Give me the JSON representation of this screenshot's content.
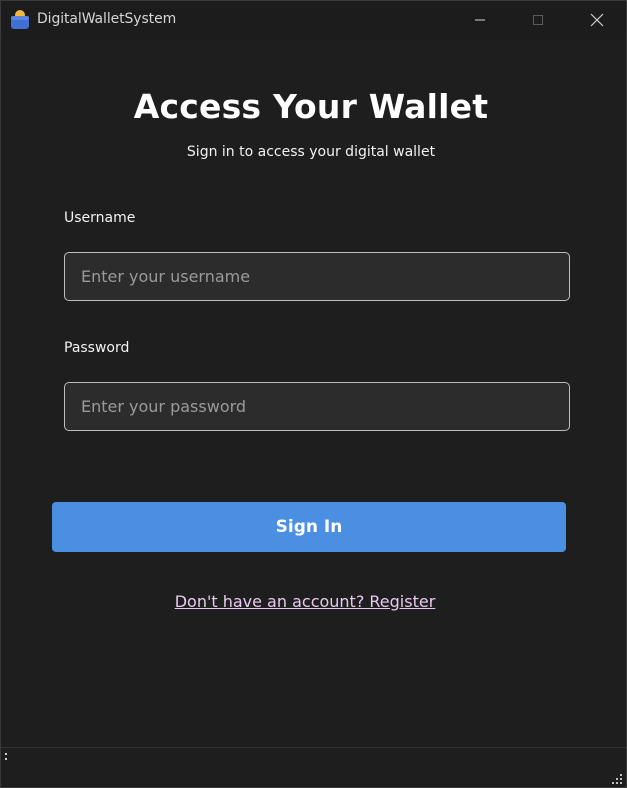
{
  "window": {
    "title": "DigitalWalletSystem",
    "controls": {
      "minimize_icon": "minimize-icon",
      "maximize_icon": "maximize-icon",
      "close_icon": "close-icon"
    }
  },
  "login": {
    "heading": "Access Your Wallet",
    "subheading": "Sign in to access your digital wallet",
    "username": {
      "label": "Username",
      "placeholder": "Enter your username",
      "value": ""
    },
    "password": {
      "label": "Password",
      "placeholder": "Enter your password",
      "value": ""
    },
    "submit_label": "Sign In",
    "register_link": "Don't have an account? Register"
  },
  "colors": {
    "background": "#1e1e1f",
    "accent": "#4a8fe2",
    "link": "#e9c8ef",
    "input_bg": "#2c2c2c",
    "input_border": "#bdbdbd"
  }
}
